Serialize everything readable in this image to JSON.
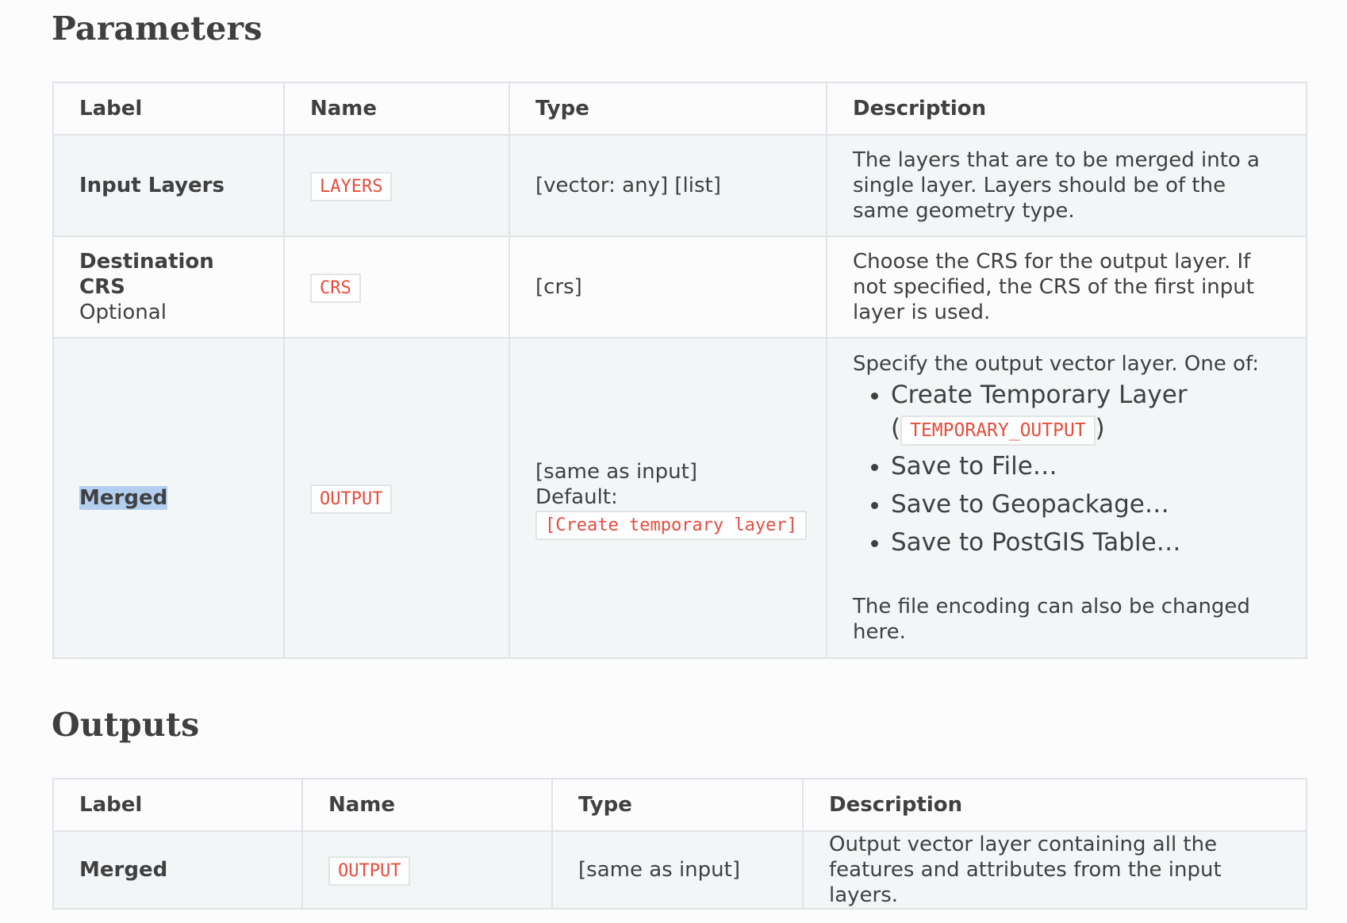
{
  "parameters": {
    "heading": "Parameters",
    "columns": [
      "Label",
      "Name",
      "Type",
      "Description"
    ],
    "rows": [
      {
        "label": "Input Layers",
        "name": "LAYERS",
        "type": "[vector: any] [list]",
        "description": "The layers that are to be merged into a single layer. Layers should be of the same geometry type."
      },
      {
        "label": "Destination CRS",
        "label_note": "Optional",
        "name": "CRS",
        "type": "[crs]",
        "description": "Choose the CRS for the output layer. If not specified, the CRS of the first input layer is used."
      },
      {
        "label": "Merged",
        "name": "OUTPUT",
        "type": "[same as input]",
        "type_default_label": "Default:",
        "type_default_value": "[Create temporary layer]",
        "description_intro": "Specify the output vector layer. One of:",
        "options": [
          {
            "text": "Create Temporary Layer",
            "code_open": "(",
            "code": "TEMPORARY_OUTPUT",
            "code_close": ")"
          },
          {
            "text": "Save to File…"
          },
          {
            "text": "Save to Geopackage…"
          },
          {
            "text": "Save to PostGIS Table…"
          }
        ],
        "description_outro": "The file encoding can also be changed here."
      }
    ]
  },
  "outputs": {
    "heading": "Outputs",
    "columns": [
      "Label",
      "Name",
      "Type",
      "Description"
    ],
    "rows": [
      {
        "label": "Merged",
        "name": "OUTPUT",
        "type": "[same as input]",
        "description": "Output vector layer containing all the features and attributes from the input layers."
      }
    ]
  }
}
